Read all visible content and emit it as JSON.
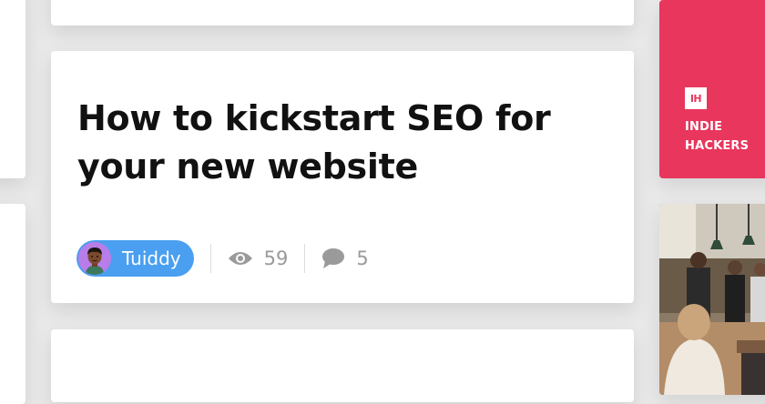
{
  "post": {
    "title": "How to kickstart SEO for your new website",
    "author": "Tuiddy",
    "views": "59",
    "comments": "5"
  },
  "ad": {
    "logo_text": "IH",
    "line1": "INDIE",
    "line2": "HACKERS",
    "color": "#e8365d"
  },
  "icons": [
    "eye-icon",
    "comment-icon"
  ],
  "colors": {
    "author_pill": "#4a9ff0",
    "avatar_bg": "#b77de8"
  }
}
